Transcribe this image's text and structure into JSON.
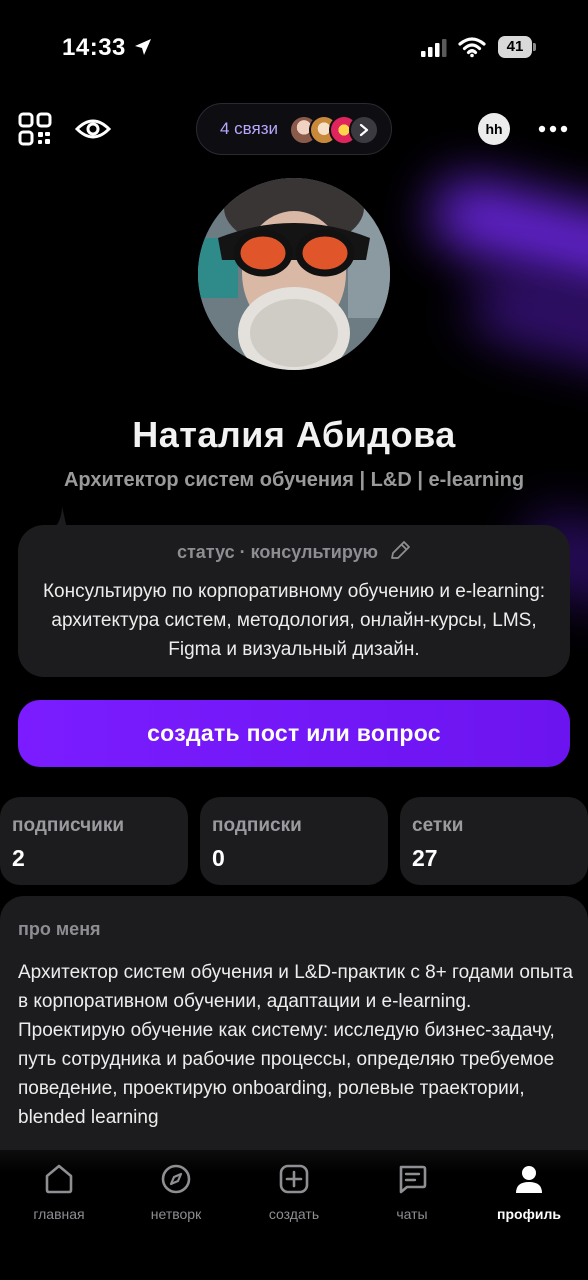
{
  "status_bar": {
    "time": "14:33",
    "battery": "41",
    "icons": [
      "location-arrow-icon",
      "signal-icon",
      "wifi-icon",
      "battery-icon"
    ]
  },
  "top_bar": {
    "links_label": "4 связи",
    "badge": "hh",
    "icons": [
      "qr-code-icon",
      "eye-icon",
      "chevron-right-icon",
      "more-dots-icon"
    ]
  },
  "profile": {
    "name": "Наталия Абидова",
    "headline": "Архитектор систем обучения | L&D | e-learning"
  },
  "status": {
    "label": "статус · консультирую",
    "text": "Консультирую по корпоративному обучению и e-learning: архитектура систем, методология, онлайн-курсы, LMS, Figma и визуальный дизайн."
  },
  "create_button": {
    "label": "создать пост или вопрос"
  },
  "stats": [
    {
      "label": "подписчики",
      "value": "2"
    },
    {
      "label": "подписки",
      "value": "0"
    },
    {
      "label": "сетки",
      "value": "27"
    }
  ],
  "about": {
    "title": "про меня",
    "paragraphs": [
      "Архитектор систем обучения и L&D-практик с 8+ годами опыта в корпоративном обучении, адаптации и e-learning.",
      "Проектирую обучение как систему: исследую бизнес-задачу, путь сотрудника и рабочие процессы, определяю требуемое поведение, проектирую onboarding, ролевые траектории, blended learning"
    ]
  },
  "nav": [
    {
      "label": "главная",
      "icon": "home-icon"
    },
    {
      "label": "нетворк",
      "icon": "compass-icon"
    },
    {
      "label": "создать",
      "icon": "plus-square-icon"
    },
    {
      "label": "чаты",
      "icon": "chat-icon"
    },
    {
      "label": "профиль",
      "icon": "person-icon",
      "active": true
    }
  ],
  "colors": {
    "accent": "#7a1cff",
    "card": "#1c1c1e",
    "links_text": "#b8a6ff"
  }
}
